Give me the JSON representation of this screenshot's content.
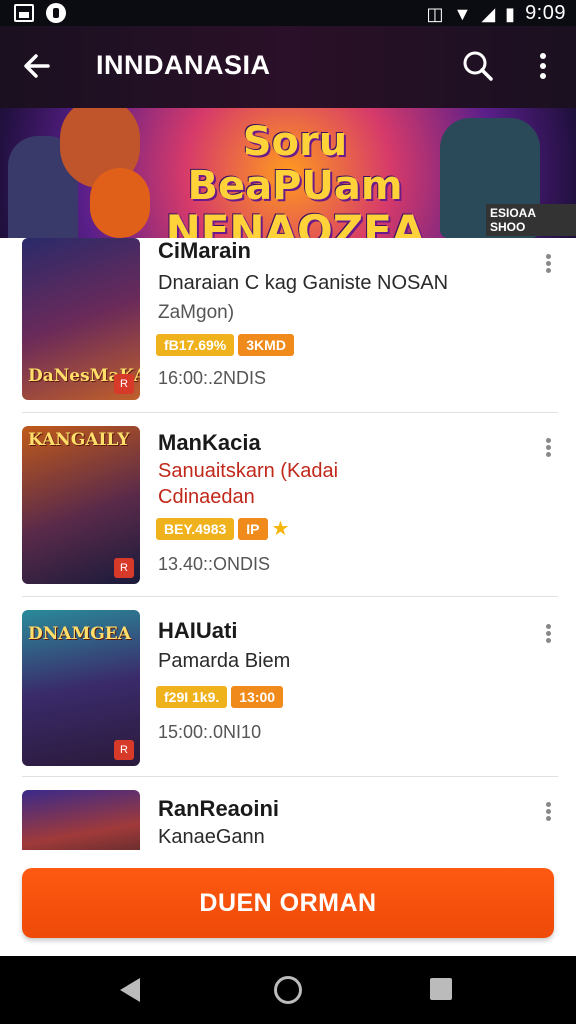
{
  "status_bar": {
    "time": "9:09",
    "icons": [
      "image-icon",
      "notification-icon",
      "vibrate-icon",
      "wifi-icon",
      "signal-icon",
      "battery-icon"
    ]
  },
  "app_bar": {
    "title": "INNDANASIA",
    "back_icon": "arrow-left-icon",
    "search_icon": "search-icon",
    "more_icon": "more-vert-icon"
  },
  "banner": {
    "line1": "Soru BeaPUam",
    "line2": "NENAQZEA",
    "side_label": "ESIOAA SHOO"
  },
  "items": [
    {
      "thumb_label": "DaNesMaKA",
      "title": "CiMarain",
      "subtitle": "Dnaraian C kag Ganiste NOSAN",
      "genre": "ZaMgon)",
      "badges": [
        "fB17.69%",
        "3KMD"
      ],
      "time": "16:00:.2NDIS"
    },
    {
      "thumb_label": "KANGAILY",
      "title": "ManKacia",
      "subtitle": "Sanuaitskarn (Kadai",
      "subtitle2": "Cdinaedan",
      "badges": [
        "BEY.4983",
        "IP"
      ],
      "time": "13.40::ONDIS"
    },
    {
      "thumb_label": "DNAMGEA",
      "title": "HAIUati",
      "subtitle": "Pamarda Biem",
      "badges": [
        "f29I 1k9.",
        "13:00"
      ],
      "time": "15:00:.0NI10"
    },
    {
      "title": "RanReaoini",
      "subtitle": "KanaeGann"
    }
  ],
  "cta": {
    "label": "DUEN ORMAN"
  },
  "nav": {
    "icons": [
      "nav-back-icon",
      "nav-home-icon",
      "nav-recent-icon"
    ]
  },
  "colors": {
    "accent": "#F24E0C",
    "badge_yellow": "#F0B21C",
    "badge_orange": "#F08A1A",
    "subtitle_red": "#C0281A"
  }
}
